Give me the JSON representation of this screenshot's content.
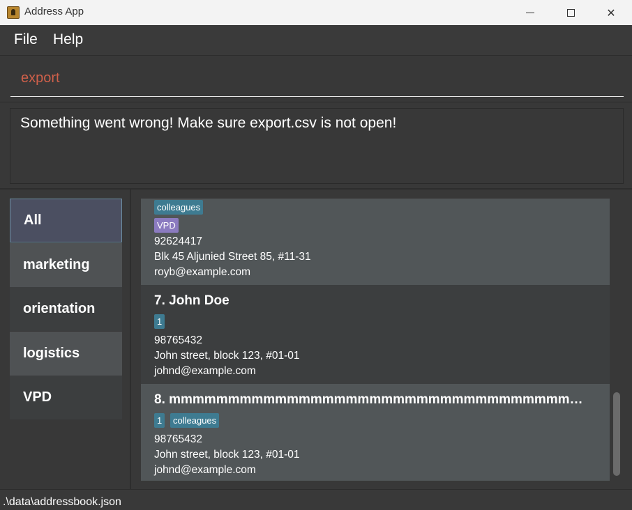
{
  "window": {
    "title": "Address App",
    "minimize_icon": "minimize-icon",
    "maximize_icon": "maximize-icon",
    "close_icon": "close-icon",
    "close_glyph": "✕"
  },
  "menu": {
    "file": "File",
    "help": "Help"
  },
  "command": {
    "value": "export",
    "text_color": "#d0604a"
  },
  "result": {
    "message": "Something went wrong! Make sure export.csv is not open!"
  },
  "sidebar": {
    "items": [
      {
        "label": "All",
        "selected": true
      },
      {
        "label": "marketing",
        "selected": false
      },
      {
        "label": "orientation",
        "selected": false
      },
      {
        "label": "logistics",
        "selected": false
      },
      {
        "label": "VPD",
        "selected": false
      }
    ]
  },
  "persons": [
    {
      "name": "",
      "tags": [
        "colleagues",
        "VPD"
      ],
      "phone": "92624417",
      "address": "Blk 45 Aljunied Street 85, #11-31",
      "email": "royb@example.com"
    },
    {
      "name": "7.  John Doe",
      "tags": [
        "1"
      ],
      "phone": "98765432",
      "address": "John street, block 123, #01-01",
      "email": "johnd@example.com"
    },
    {
      "name": "8.  mmmmmmmmmmmmmmmmmmmmmmmmmmmmmmmmmmmmmm...",
      "tags": [
        "1",
        "colleagues"
      ],
      "phone": "98765432",
      "address": "John street, block 123, #01-01",
      "email": "johnd@example.com"
    }
  ],
  "status": {
    "path": ".\\data\\addressbook.json"
  },
  "colors": {
    "tag_blue": "#3e7b91",
    "tag_purple": "#8b7bc0",
    "selected_item": "#4b4f61"
  }
}
